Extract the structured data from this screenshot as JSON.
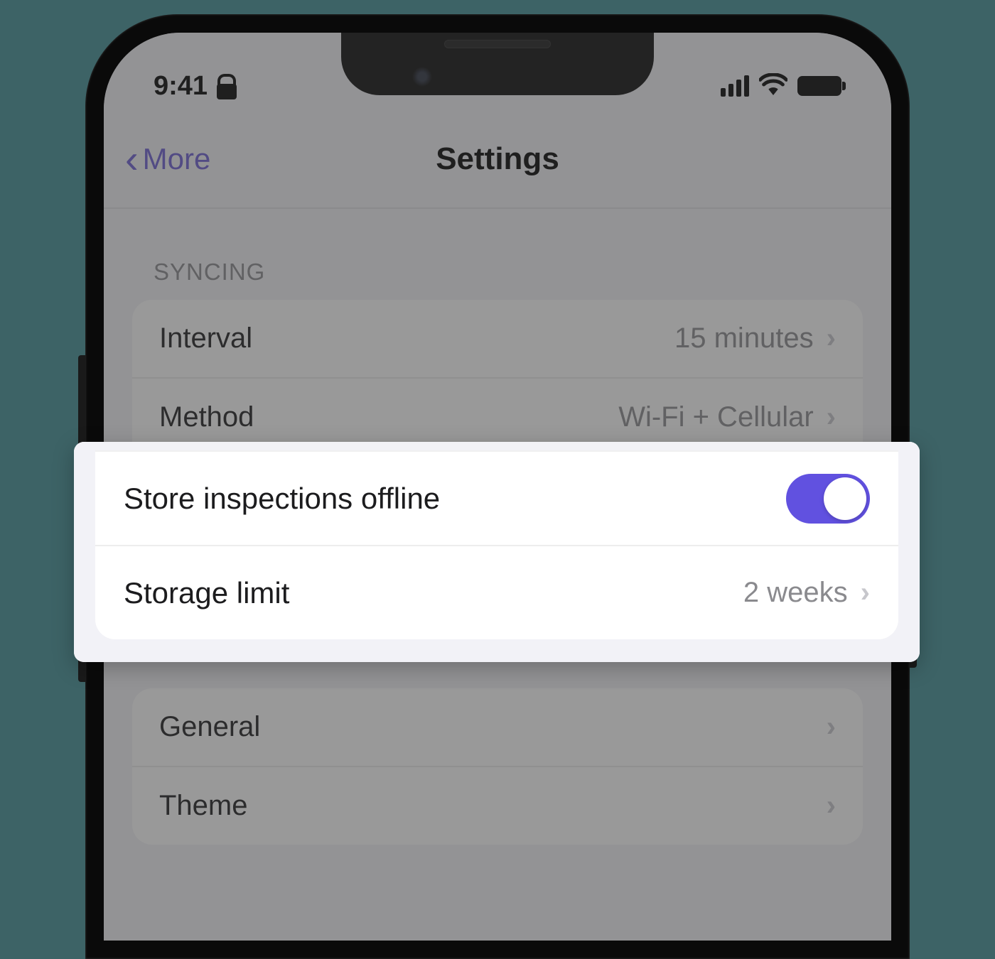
{
  "status": {
    "time": "9:41"
  },
  "nav": {
    "back_label": "More",
    "title": "Settings"
  },
  "syncing": {
    "header": "SYNCING",
    "interval": {
      "label": "Interval",
      "value": "15 minutes"
    },
    "method": {
      "label": "Method",
      "value": "Wi-Fi + Cellular"
    },
    "store_offline": {
      "label": "Store inspections offline",
      "on": true
    },
    "storage_limit": {
      "label": "Storage limit",
      "value": "2 weeks"
    }
  },
  "general_group": {
    "general": {
      "label": "General"
    },
    "theme": {
      "label": "Theme"
    }
  }
}
